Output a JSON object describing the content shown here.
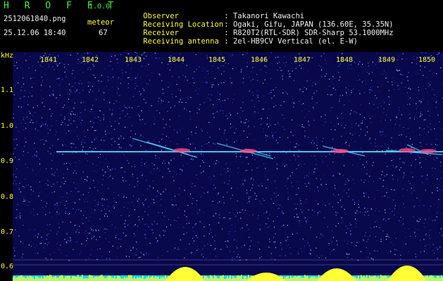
{
  "header": {
    "app_title": "H R O F F T",
    "app_version": "1.0.0",
    "file_name": "2512061840.png",
    "date_time": "25.12.06 18:40",
    "meteor_label": "meteor",
    "meteor_count": "67"
  },
  "info": [
    {
      "label": "Observer",
      "sep": ": ",
      "value": "Takanori Kawachi"
    },
    {
      "label": "Receiving Location",
      "sep": ": ",
      "value": "Ogaki, Gifu, JAPAN (136.60E, 35.35N)"
    },
    {
      "label": "Receiver",
      "sep": ": ",
      "value": "R820T2(RTL-SDR) SDR-Sharp 53.1000MHz"
    },
    {
      "label": "Receiving antenna",
      "sep": ": ",
      "value": "2el-HB9CV Vertical (el. E-W)"
    }
  ],
  "plot": {
    "y_unit": "kHz",
    "x_ticks": [
      "1841",
      "1842",
      "1843",
      "1844",
      "1845",
      "1846",
      "1847",
      "1848",
      "1849",
      "1850"
    ],
    "y_ticks": [
      "1.1",
      "1.0",
      "0.9",
      "0.8",
      "0.7",
      "0.6"
    ],
    "background_color": "#08084a",
    "carrier_color": "#4fd8ff",
    "echo_color": "#ff4a8a",
    "level_color": "#ffff33",
    "noise_floor_color": "#00d8ff"
  }
}
